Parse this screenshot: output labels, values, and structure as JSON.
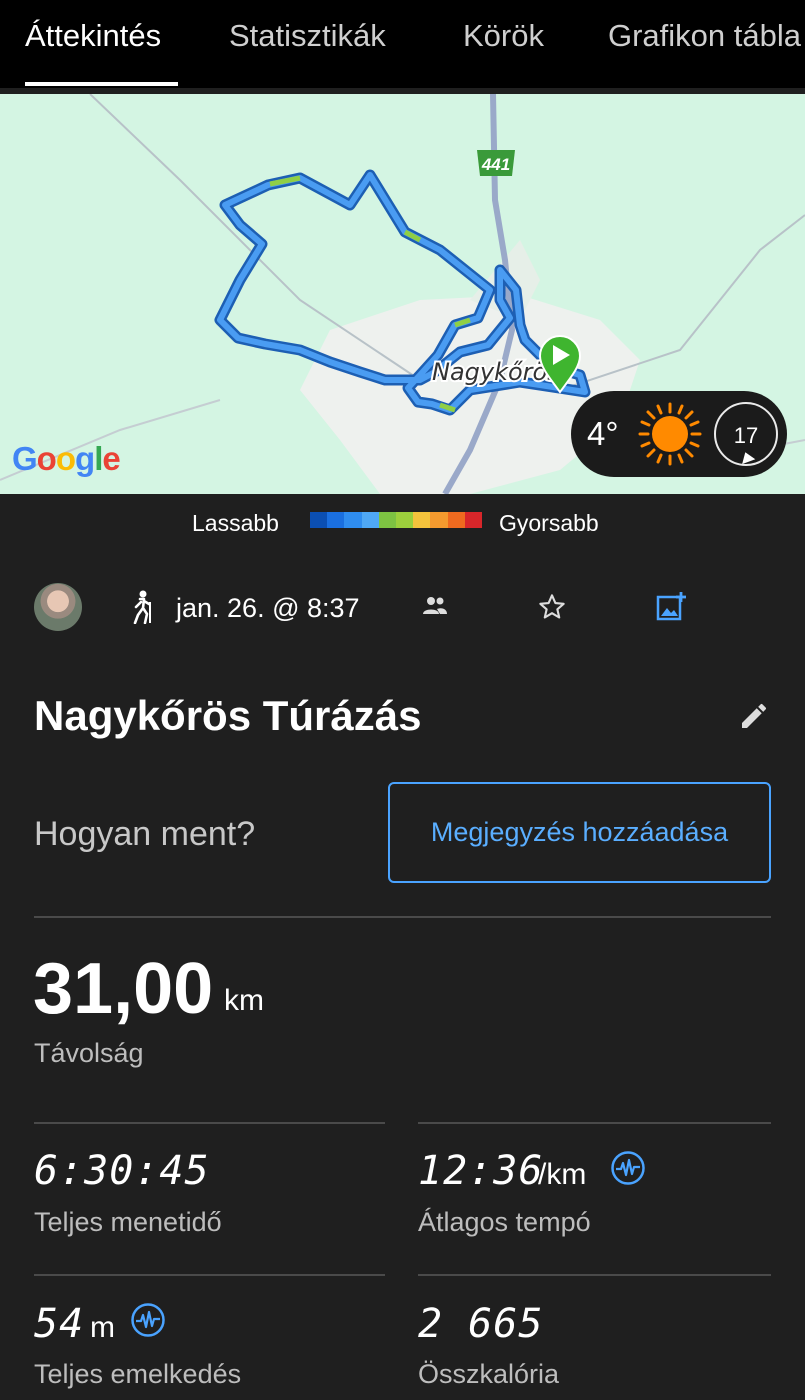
{
  "tabs": [
    {
      "label": "Áttekintés",
      "active": true
    },
    {
      "label": "Statisztikák",
      "active": false
    },
    {
      "label": "Körök",
      "active": false
    },
    {
      "label": "Grafikon tábla",
      "active": false
    }
  ],
  "map": {
    "road_label": "441",
    "town_label": "Nagykőrös",
    "attribution": "Google",
    "weather": {
      "temperature": "4°",
      "wind_speed": "17",
      "icon": "sun-icon"
    }
  },
  "legend": {
    "slow_label": "Lassabb",
    "fast_label": "Gyorsabb",
    "colors": [
      "#0b4fb3",
      "#1a6fe0",
      "#2f8df0",
      "#4fa8f5",
      "#7dc242",
      "#9ccf3c",
      "#f5c33c",
      "#f59a2e",
      "#ef6a1f",
      "#d8262a"
    ]
  },
  "activity": {
    "type_icon": "hiking-icon",
    "date": "jan. 26. @ 8:37",
    "title": "Nagykőrös Túrázás"
  },
  "note": {
    "prompt": "Hogyan ment?",
    "button_label": "Megjegyzés hozzáadása"
  },
  "distance": {
    "value": "31,00",
    "unit": "km",
    "label": "Távolság"
  },
  "stats": [
    {
      "value": "6:30:45",
      "unit": "",
      "label": "Teljes menetidő"
    },
    {
      "value": "12:36",
      "unit": "/km",
      "label": "Átlagos tempó"
    },
    {
      "value": "54",
      "unit": "m",
      "label": "Teljes emelkedés"
    },
    {
      "value": "2 665",
      "unit": "",
      "label": "Összkalória"
    }
  ],
  "colors": {
    "accent": "#4aa3ff",
    "route": "#3d8fe6",
    "start": "#3fb52f",
    "background": "#1f1f1f"
  }
}
